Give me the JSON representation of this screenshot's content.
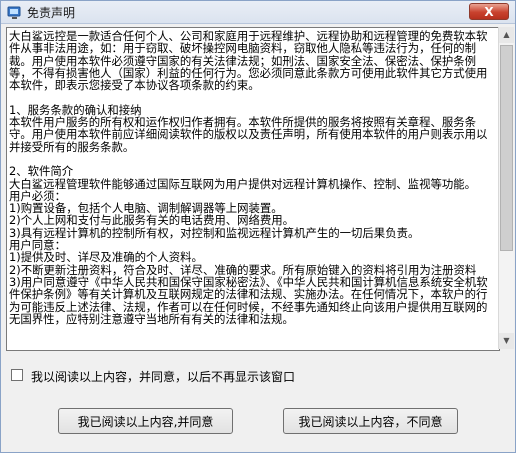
{
  "window": {
    "title": "免责声明",
    "close_label": "X"
  },
  "content": {
    "disclaimer_text": "大白鲨远控是一款适合任何个人、公司和家庭用于远程维护、远程协助和远程管理的免费软本软件从事非法用途，如：用于窃取、破坏操控网电脑资料，窃取他人隐私等违法行为，任何的制裁。用户使用本软件必须遵守国家的有关法律法规；如刑法、国家安全法、保密法、保护条例等，不得有损害他人（国家）利益的任何行为。您必须同意此条款方可使用此软件其它方式使用本软件，即表示您接受了本协议各项条款的约束。\n\n1、服务条款的确认和接纳\n本软件用户服务的所有权和运作权归作者拥有。本软件所提供的服务将按照有关章程、服务条守。用户使用本软件前应详细阅读软件的版权以及责任声明，所有使用本软件的用户则表示用以并接受所有的服务条款。\n\n2、软件简介\n大白鲨远程管理软件能够通过国际互联网为用户提供对远程计算机操作、控制、监视等功能。\n用户必须：\n1)购置设备，包括个人电脑、调制解调器等上网装置。\n2)个人上网和支付与此服务有关的电话费用、网络费用。\n3)具有远程计算机的控制所有权，对控制和监视远程计算机产生的一切后果负责。\n用户同意：\n1)提供及时、详尽及准确的个人资料。\n2)不断更新注册资料，符合及时、详尽、准确的要求。所有原始键入的资料将引用为注册资料\n3)用户同意遵守《中华人民共和国保守国家秘密法》、《中华人民共和国计算机信息系统安全机软件保护条例》等有关计算机及互联网规定的法律和法规、实施办法。在任何情况下，本软户的行为可能违反上述法律、法规，作者可以在任何时候，不经事先通知终止向该用户提供用互联网的无国界性，应特别注意遵守当地所有有关的法律和法规。"
  },
  "checkbox": {
    "label": "我以阅读以上内容，并同意，以后不再显示该窗口",
    "checked": false
  },
  "buttons": {
    "agree": "我已阅读以上内容,并同意",
    "disagree": "我已阅读以上内容，不同意"
  }
}
